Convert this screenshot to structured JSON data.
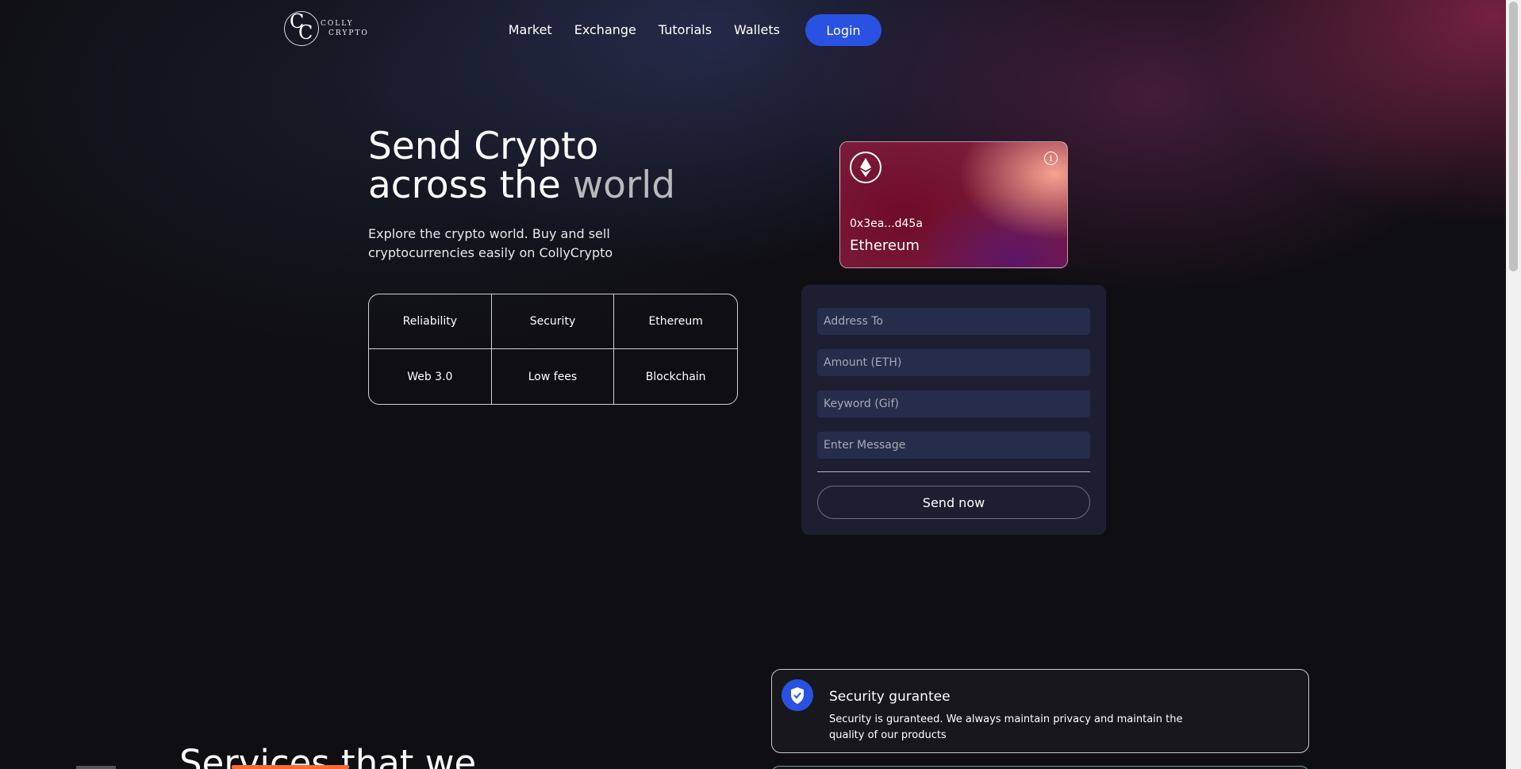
{
  "brand": {
    "logo_initials_1": "C",
    "logo_initials_2": "C",
    "logo_line_1": "COLLY",
    "logo_line_2": "CRYPTO"
  },
  "nav": {
    "links": [
      "Market",
      "Exchange",
      "Tutorials",
      "Wallets"
    ],
    "login_label": "Login"
  },
  "hero": {
    "title_line_1": "Send Crypto",
    "title_line_2_start": "across the ",
    "title_line_2_end": "world",
    "subtitle": "Explore the crypto world. Buy and sell cryptocurrencies easily on CollyCrypto",
    "features": [
      "Reliability",
      "Security",
      "Ethereum",
      "Web 3.0",
      "Low fees",
      "Blockchain"
    ]
  },
  "card": {
    "address": "0x3ea...d45a",
    "network": "Ethereum",
    "info_glyph": "i",
    "icons": [
      "ethereum-icon",
      "info-icon"
    ]
  },
  "form": {
    "address_placeholder": "Address To",
    "amount_placeholder": "Amount (ETH)",
    "keyword_placeholder": "Keyword (Gif)",
    "message_placeholder": "Enter Message",
    "send_label": "Send now"
  },
  "services": {
    "heading": "Services that we",
    "items": [
      {
        "title": "Security gurantee",
        "description": "Security is guranteed. We always maintain privacy and maintain the quality of our products",
        "icon": "shield-check-icon"
      }
    ]
  },
  "colors": {
    "accent": "#2952e3",
    "background": "#0f0e13",
    "highlight": "#ff6b2c"
  }
}
